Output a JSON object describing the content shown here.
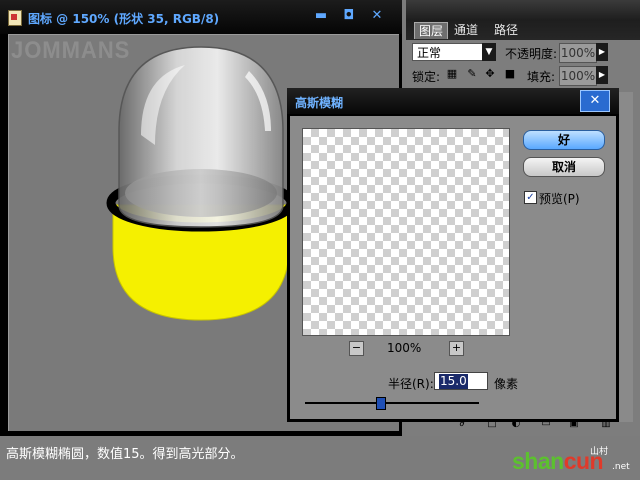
{
  "document": {
    "title": "图标 @ 150% (形状 35, RGB/8)",
    "watermark": "JOMMANS",
    "minimize_glyph": "▬",
    "restore_glyph": "◘",
    "close_glyph": "✕"
  },
  "layers_panel": {
    "tabs": [
      "图层",
      "通道",
      "路径"
    ],
    "blend_mode": "正常",
    "opacity_label": "不透明度:",
    "opacity_value": "100%",
    "lock_label": "锁定:",
    "fill_label": "填充:",
    "fill_value": "100%"
  },
  "dialog": {
    "title": "高斯模糊",
    "close_glyph": "✕",
    "ok_label": "好",
    "cancel_label": "取消",
    "preview_label": "预览(P)",
    "preview_checked": true,
    "zoom_out_glyph": "−",
    "zoom_in_glyph": "+",
    "zoom_level": "100%",
    "radius_label": "半径(R):",
    "radius_value": "15.0",
    "radius_unit": "像素",
    "radius_slider_fraction": 0.43
  },
  "caption": "高斯模糊椭圆，数值15。得到高光部分。",
  "brand": {
    "name_part1": "shan",
    "name_part2": "cun",
    "sub_text": "山村",
    "tld": ".net",
    "color_green": "#5cc12e",
    "color_red": "#e03a2a"
  },
  "colors": {
    "yellow_fill": "#f5f000",
    "accent_blue": "#5fa8ff",
    "canvas_gray": "#7a7a7a"
  }
}
